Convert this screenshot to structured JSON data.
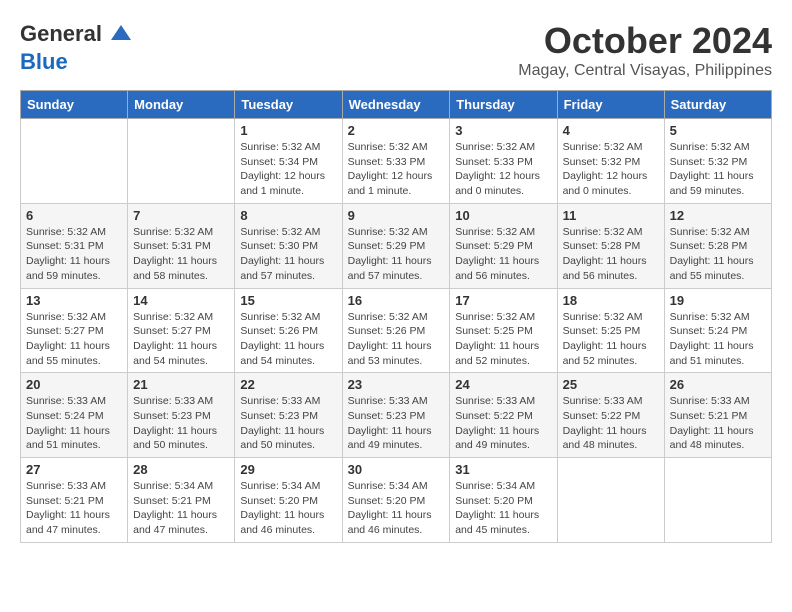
{
  "header": {
    "logo_line1": "General",
    "logo_line2": "Blue",
    "month": "October 2024",
    "location": "Magay, Central Visayas, Philippines"
  },
  "weekdays": [
    "Sunday",
    "Monday",
    "Tuesday",
    "Wednesday",
    "Thursday",
    "Friday",
    "Saturday"
  ],
  "weeks": [
    [
      {
        "day": "",
        "info": ""
      },
      {
        "day": "",
        "info": ""
      },
      {
        "day": "1",
        "info": "Sunrise: 5:32 AM\nSunset: 5:34 PM\nDaylight: 12 hours\nand 1 minute."
      },
      {
        "day": "2",
        "info": "Sunrise: 5:32 AM\nSunset: 5:33 PM\nDaylight: 12 hours\nand 1 minute."
      },
      {
        "day": "3",
        "info": "Sunrise: 5:32 AM\nSunset: 5:33 PM\nDaylight: 12 hours\nand 0 minutes."
      },
      {
        "day": "4",
        "info": "Sunrise: 5:32 AM\nSunset: 5:32 PM\nDaylight: 12 hours\nand 0 minutes."
      },
      {
        "day": "5",
        "info": "Sunrise: 5:32 AM\nSunset: 5:32 PM\nDaylight: 11 hours\nand 59 minutes."
      }
    ],
    [
      {
        "day": "6",
        "info": "Sunrise: 5:32 AM\nSunset: 5:31 PM\nDaylight: 11 hours\nand 59 minutes."
      },
      {
        "day": "7",
        "info": "Sunrise: 5:32 AM\nSunset: 5:31 PM\nDaylight: 11 hours\nand 58 minutes."
      },
      {
        "day": "8",
        "info": "Sunrise: 5:32 AM\nSunset: 5:30 PM\nDaylight: 11 hours\nand 57 minutes."
      },
      {
        "day": "9",
        "info": "Sunrise: 5:32 AM\nSunset: 5:29 PM\nDaylight: 11 hours\nand 57 minutes."
      },
      {
        "day": "10",
        "info": "Sunrise: 5:32 AM\nSunset: 5:29 PM\nDaylight: 11 hours\nand 56 minutes."
      },
      {
        "day": "11",
        "info": "Sunrise: 5:32 AM\nSunset: 5:28 PM\nDaylight: 11 hours\nand 56 minutes."
      },
      {
        "day": "12",
        "info": "Sunrise: 5:32 AM\nSunset: 5:28 PM\nDaylight: 11 hours\nand 55 minutes."
      }
    ],
    [
      {
        "day": "13",
        "info": "Sunrise: 5:32 AM\nSunset: 5:27 PM\nDaylight: 11 hours\nand 55 minutes."
      },
      {
        "day": "14",
        "info": "Sunrise: 5:32 AM\nSunset: 5:27 PM\nDaylight: 11 hours\nand 54 minutes."
      },
      {
        "day": "15",
        "info": "Sunrise: 5:32 AM\nSunset: 5:26 PM\nDaylight: 11 hours\nand 54 minutes."
      },
      {
        "day": "16",
        "info": "Sunrise: 5:32 AM\nSunset: 5:26 PM\nDaylight: 11 hours\nand 53 minutes."
      },
      {
        "day": "17",
        "info": "Sunrise: 5:32 AM\nSunset: 5:25 PM\nDaylight: 11 hours\nand 52 minutes."
      },
      {
        "day": "18",
        "info": "Sunrise: 5:32 AM\nSunset: 5:25 PM\nDaylight: 11 hours\nand 52 minutes."
      },
      {
        "day": "19",
        "info": "Sunrise: 5:32 AM\nSunset: 5:24 PM\nDaylight: 11 hours\nand 51 minutes."
      }
    ],
    [
      {
        "day": "20",
        "info": "Sunrise: 5:33 AM\nSunset: 5:24 PM\nDaylight: 11 hours\nand 51 minutes."
      },
      {
        "day": "21",
        "info": "Sunrise: 5:33 AM\nSunset: 5:23 PM\nDaylight: 11 hours\nand 50 minutes."
      },
      {
        "day": "22",
        "info": "Sunrise: 5:33 AM\nSunset: 5:23 PM\nDaylight: 11 hours\nand 50 minutes."
      },
      {
        "day": "23",
        "info": "Sunrise: 5:33 AM\nSunset: 5:23 PM\nDaylight: 11 hours\nand 49 minutes."
      },
      {
        "day": "24",
        "info": "Sunrise: 5:33 AM\nSunset: 5:22 PM\nDaylight: 11 hours\nand 49 minutes."
      },
      {
        "day": "25",
        "info": "Sunrise: 5:33 AM\nSunset: 5:22 PM\nDaylight: 11 hours\nand 48 minutes."
      },
      {
        "day": "26",
        "info": "Sunrise: 5:33 AM\nSunset: 5:21 PM\nDaylight: 11 hours\nand 48 minutes."
      }
    ],
    [
      {
        "day": "27",
        "info": "Sunrise: 5:33 AM\nSunset: 5:21 PM\nDaylight: 11 hours\nand 47 minutes."
      },
      {
        "day": "28",
        "info": "Sunrise: 5:34 AM\nSunset: 5:21 PM\nDaylight: 11 hours\nand 47 minutes."
      },
      {
        "day": "29",
        "info": "Sunrise: 5:34 AM\nSunset: 5:20 PM\nDaylight: 11 hours\nand 46 minutes."
      },
      {
        "day": "30",
        "info": "Sunrise: 5:34 AM\nSunset: 5:20 PM\nDaylight: 11 hours\nand 46 minutes."
      },
      {
        "day": "31",
        "info": "Sunrise: 5:34 AM\nSunset: 5:20 PM\nDaylight: 11 hours\nand 45 minutes."
      },
      {
        "day": "",
        "info": ""
      },
      {
        "day": "",
        "info": ""
      }
    ]
  ]
}
